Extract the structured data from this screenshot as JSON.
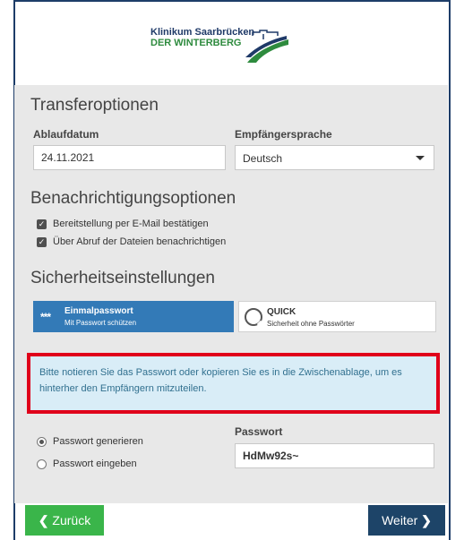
{
  "logo": {
    "line1": "Klinikum Saarbrücken",
    "line2": "DER WINTERBERG",
    "icon": "clinic-logo-icon"
  },
  "transfer": {
    "title": "Transferoptionen",
    "expiry_label": "Ablaufdatum",
    "expiry_value": "24.11.2021",
    "language_label": "Empfängersprache",
    "language_value": "Deutsch"
  },
  "notifications": {
    "title": "Benachrichtigungsoptionen",
    "options": [
      {
        "label": "Bereitstellung per E-Mail bestätigen",
        "checked": true
      },
      {
        "label": "Über Abruf der Dateien benachrichtigen",
        "checked": true
      }
    ]
  },
  "security": {
    "title": "Sicherheitseinstellungen",
    "otp_title": "Einmalpasswort",
    "otp_sub": "Mit Passwort schützen",
    "otp_icon": "***",
    "quick_title": "QUICK",
    "quick_sub": "Sicherheit ohne Passwörter"
  },
  "info": {
    "text": "Bitte notieren Sie das Passwort oder kopieren Sie es in die Zwischenablage, um es hinterher den Empfängern mitzuteilen."
  },
  "password": {
    "generate_label": "Passwort generieren",
    "enter_label": "Passwort eingeben",
    "field_label": "Passwort",
    "value": "HdMw92s~"
  },
  "nav": {
    "back_label": "Zurück",
    "next_label": "Weiter"
  },
  "colors": {
    "primary": "#337ab7",
    "back_button": "#3ab54a",
    "next_button": "#1d4468",
    "highlight_border": "#e0001a",
    "info_background": "#d9edf7"
  }
}
